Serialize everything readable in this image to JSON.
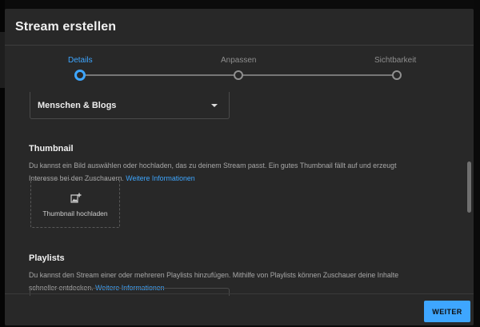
{
  "dialog": {
    "title": "Stream erstellen"
  },
  "stepper": {
    "steps": [
      {
        "label": "Details",
        "active": true
      },
      {
        "label": "Anpassen",
        "active": false
      },
      {
        "label": "Sichtbarkeit",
        "active": false
      }
    ]
  },
  "category": {
    "selected": "Menschen & Blogs"
  },
  "thumbnail": {
    "title": "Thumbnail",
    "description_line1": "Du kannst ein Bild auswählen oder hochladen, das zu deinem Stream passt. Ein gutes Thumbnail fällt auf und erzeugt",
    "description_line2": "Interesse bei den Zuschauern.",
    "link": "Weitere Informationen",
    "upload_label": "Thumbnail hochladen",
    "upload_icon": "add-photo-icon"
  },
  "playlists": {
    "title": "Playlists",
    "description_line1": "Du kannst den Stream einer oder mehreren Playlists hinzufügen. Mithilfe von Playlists können Zuschauer deine Inhalte",
    "description_line2": "schneller entdecken.",
    "link": "Weitere Informationen"
  },
  "footer": {
    "next_label": "WEITER"
  },
  "colors": {
    "accent": "#3ea6ff",
    "dialog_bg": "#282828",
    "muted_text": "#a7a7a7"
  }
}
